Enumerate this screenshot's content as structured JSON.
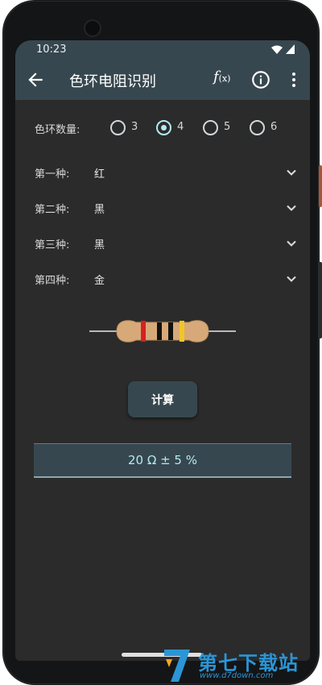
{
  "status_bar": {
    "time": "10:23"
  },
  "app_bar": {
    "title": "色环电阻识别",
    "fx_label": "f",
    "fx_sub": "(x)"
  },
  "band_count": {
    "label": "色环数量:",
    "options": [
      "3",
      "4",
      "5",
      "6"
    ],
    "selected": "4"
  },
  "bands": [
    {
      "label": "第一种:",
      "value": "红"
    },
    {
      "label": "第二种:",
      "value": "黑"
    },
    {
      "label": "第三种:",
      "value": "黑"
    },
    {
      "label": "第四种:",
      "value": "金"
    }
  ],
  "resistor_colors": {
    "body": "#d8a978",
    "band1": "#d32222",
    "band2": "#111111",
    "band3": "#111111",
    "band4": "#f2c52a"
  },
  "calculate_label": "计算",
  "result": "20 Ω ± 5 %",
  "colors": {
    "app_bar": "#37474f",
    "screen_bg": "#2b2b2b",
    "accent": "#b2ebf2"
  },
  "watermark": {
    "name": "第七下载站",
    "url": "www.d7down.com"
  }
}
